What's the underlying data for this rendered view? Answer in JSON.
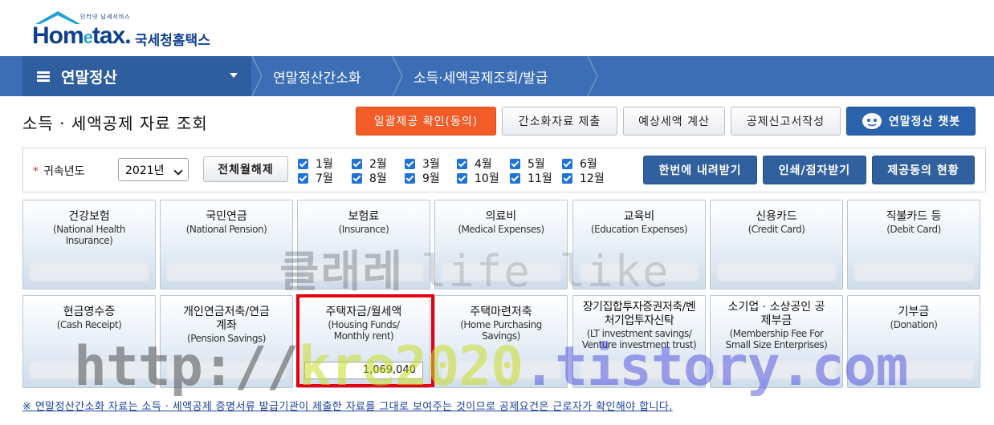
{
  "logo": {
    "sub": "인터넷 납세서비스",
    "brand_a": "Hom",
    "brand_e": "e",
    "brand_b": "tax.",
    "kor": "국세청홈택스"
  },
  "nav": {
    "home": "연말정산",
    "crumb1": "연말정산간소화",
    "crumb2": "소득·세액공제조회/발급"
  },
  "title": "소득 · 세액공제 자료 조회",
  "buttons": {
    "consent": "일괄제공 확인(동의)",
    "submit": "간소화자료 제출",
    "estimate": "예상세액 계산",
    "form": "공제신고서작성",
    "chatbot": "연말정산 챗봇",
    "download": "한번에 내려받기",
    "print": "인쇄/점자받기",
    "status": "제공동의 현황",
    "clear_all": "전체월해제"
  },
  "filter": {
    "label": "귀속년도",
    "year": "2021년",
    "months": [
      "1월",
      "2월",
      "3월",
      "4월",
      "5월",
      "6월",
      "7월",
      "8월",
      "9월",
      "10월",
      "11월",
      "12월"
    ]
  },
  "tiles": [
    {
      "k": "건강보험",
      "e": "(National Health Insurance)"
    },
    {
      "k": "국민연금",
      "e": "(National Pension)"
    },
    {
      "k": "보험료",
      "e": "(Insurance)"
    },
    {
      "k": "의료비",
      "e": "(Medical Expenses)"
    },
    {
      "k": "교육비",
      "e": "(Education Expenses)"
    },
    {
      "k": "신용카드",
      "e": "(Credit Card)"
    },
    {
      "k": "직불카드 등",
      "e": "(Debit Card)"
    },
    {
      "k": "현금영수증",
      "e": "(Cash Receipt)"
    },
    {
      "k": "개인연금저축/연금계좌",
      "e": "(Pension Savings)"
    },
    {
      "k": "주택자금/월세액",
      "e": "(Housing Funds/ Monthly rent)",
      "amount": "1,069,040"
    },
    {
      "k": "주택마련저축",
      "e": "(Home Purchasing Savings)"
    },
    {
      "k": "장기집합투자증권저축/벤처기업투자신탁",
      "e": "(LT investment savings/ Venture investment trust)"
    },
    {
      "k": "소기업 · 소상공인 공제부금",
      "e": "(Membership Fee For Small Size Enterprises)"
    },
    {
      "k": "기부금",
      "e": "(Donation)"
    }
  ],
  "notice": "※ 연말정산간소화 자료는 소득 · 세액공제 증명서류 발급기관이 제출한 자료를 그대로 보여주는 것이므로 공제요건은 근로자가 확인해야 합니다.",
  "watermark": {
    "top_kor": "클래레",
    "top_en": "life like",
    "url_a": "http://",
    "url_b": "kre2020",
    "url_c": ".tistory.com"
  }
}
